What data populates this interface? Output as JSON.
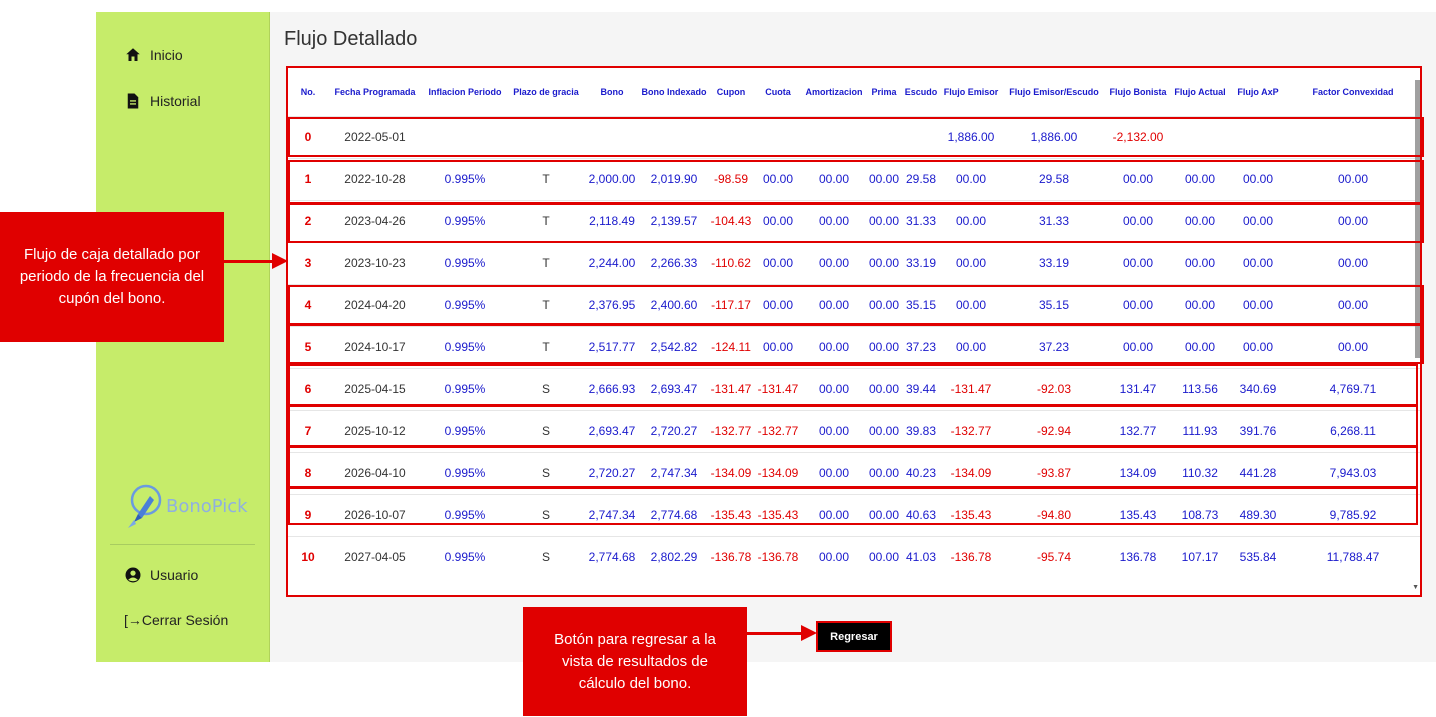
{
  "sidebar": {
    "items": [
      {
        "label": "Inicio",
        "icon": "home-icon"
      },
      {
        "label": "Historial",
        "icon": "file-icon"
      }
    ],
    "brand": "BonoPick",
    "user_label": "Usuario",
    "logout_label": "[→Cerrar Sesión"
  },
  "main": {
    "title": "Flujo Detallado",
    "back_button": "Regresar"
  },
  "table": {
    "headers": [
      "No.",
      "Fecha Programada",
      "Inflacion Periodo",
      "Plazo de gracia",
      "Bono",
      "Bono Indexado",
      "Cupon",
      "Cuota",
      "Amortizacion",
      "Prima",
      "Escudo",
      "Flujo Emisor",
      "Flujo Emisor/Escudo",
      "Flujo Bonista",
      "Flujo Actual",
      "Flujo AxP",
      "Factor Convexidad"
    ],
    "rows": [
      [
        "0",
        "2022-05-01",
        "",
        "",
        "",
        "",
        "",
        "",
        "",
        "",
        "",
        "1,886.00",
        "1,886.00",
        "-2,132.00",
        "",
        "",
        ""
      ],
      [
        "1",
        "2022-10-28",
        "0.995%",
        "T",
        "2,000.00",
        "2,019.90",
        "-98.59",
        "00.00",
        "00.00",
        "00.00",
        "29.58",
        "00.00",
        "29.58",
        "00.00",
        "00.00",
        "00.00",
        "00.00"
      ],
      [
        "2",
        "2023-04-26",
        "0.995%",
        "T",
        "2,118.49",
        "2,139.57",
        "-104.43",
        "00.00",
        "00.00",
        "00.00",
        "31.33",
        "00.00",
        "31.33",
        "00.00",
        "00.00",
        "00.00",
        "00.00"
      ],
      [
        "3",
        "2023-10-23",
        "0.995%",
        "T",
        "2,244.00",
        "2,266.33",
        "-110.62",
        "00.00",
        "00.00",
        "00.00",
        "33.19",
        "00.00",
        "33.19",
        "00.00",
        "00.00",
        "00.00",
        "00.00"
      ],
      [
        "4",
        "2024-04-20",
        "0.995%",
        "T",
        "2,376.95",
        "2,400.60",
        "-117.17",
        "00.00",
        "00.00",
        "00.00",
        "35.15",
        "00.00",
        "35.15",
        "00.00",
        "00.00",
        "00.00",
        "00.00"
      ],
      [
        "5",
        "2024-10-17",
        "0.995%",
        "T",
        "2,517.77",
        "2,542.82",
        "-124.11",
        "00.00",
        "00.00",
        "00.00",
        "37.23",
        "00.00",
        "37.23",
        "00.00",
        "00.00",
        "00.00",
        "00.00"
      ],
      [
        "6",
        "2025-04-15",
        "0.995%",
        "S",
        "2,666.93",
        "2,693.47",
        "-131.47",
        "-131.47",
        "00.00",
        "00.00",
        "39.44",
        "-131.47",
        "-92.03",
        "131.47",
        "113.56",
        "340.69",
        "4,769.71"
      ],
      [
        "7",
        "2025-10-12",
        "0.995%",
        "S",
        "2,693.47",
        "2,720.27",
        "-132.77",
        "-132.77",
        "00.00",
        "00.00",
        "39.83",
        "-132.77",
        "-92.94",
        "132.77",
        "111.93",
        "391.76",
        "6,268.11"
      ],
      [
        "8",
        "2026-04-10",
        "0.995%",
        "S",
        "2,720.27",
        "2,747.34",
        "-134.09",
        "-134.09",
        "00.00",
        "00.00",
        "40.23",
        "-134.09",
        "-93.87",
        "134.09",
        "110.32",
        "441.28",
        "7,943.03"
      ],
      [
        "9",
        "2026-10-07",
        "0.995%",
        "S",
        "2,747.34",
        "2,774.68",
        "-135.43",
        "-135.43",
        "00.00",
        "00.00",
        "40.63",
        "-135.43",
        "-94.80",
        "135.43",
        "108.73",
        "489.30",
        "9,785.92"
      ],
      [
        "10",
        "2027-04-05",
        "0.995%",
        "S",
        "2,774.68",
        "2,802.29",
        "-136.78",
        "-136.78",
        "00.00",
        "00.00",
        "41.03",
        "-136.78",
        "-95.74",
        "136.78",
        "107.17",
        "535.84",
        "11,788.47"
      ]
    ]
  },
  "annotations": {
    "left": "Flujo de caja detallado por periodo de la frecuencia del cupón del bono.",
    "bottom": "Botón para regresar a la vista de resultados de cálculo del bono."
  },
  "colors": {
    "sidebar_bg": "#c6ec6a",
    "highlight": "#e00000",
    "value_blue": "#1a1acc",
    "negative_red": "#e00000"
  }
}
